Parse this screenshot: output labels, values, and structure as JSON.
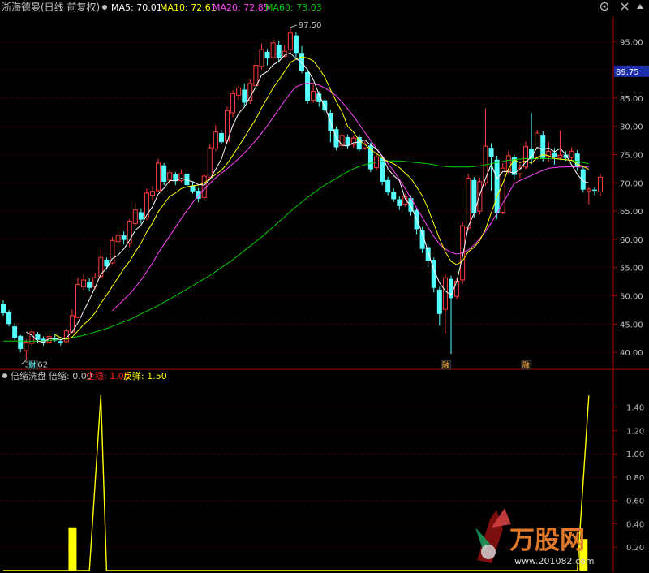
{
  "header": {
    "stock": "浙海德曼(日线 前复权)",
    "ma5": "MA5: 70.01",
    "ma10": "MA10: 72.61",
    "ma20": "MA20: 72.85",
    "ma60": "MA60: 73.03"
  },
  "indicator_header": {
    "name": "倍缩洗盘",
    "v1": "倍缩: 0.00",
    "v2": "企稳: 1.00",
    "v3": "反弹: 1.50"
  },
  "watermark": {
    "brand": "万股网",
    "url": "www.201082.com"
  },
  "colors": {
    "up": "#ff3b3b",
    "down": "#54ffff",
    "ma5": "#ffffff",
    "ma10": "#ffff00",
    "ma20": "#ff44ff",
    "ma60": "#00cc00",
    "axis": "#b00000",
    "grid": "#7a0000",
    "axis_text": "#c0c0c0",
    "bar": "#ffff00"
  },
  "chart_data": [
    {
      "type": "candlestick",
      "title": "浙海德曼(日线 前复权)",
      "y_ticks": [
        40.0,
        45.0,
        50.0,
        55.0,
        60.0,
        65.0,
        70.0,
        75.0,
        80.0,
        85.0,
        90.0,
        95.0
      ],
      "ylim": [
        37.0,
        99.5
      ],
      "y_tick_labels": [
        "40.00",
        "45.00",
        "50.00",
        "55.00",
        "60.00",
        "65.00",
        "70.00",
        "75.00",
        "80.00",
        "85.00",
        "90.00",
        "95.00"
      ],
      "current_price": "89.75",
      "current_price_value": 89.75,
      "high_label": "97.50",
      "low_label": "38.62",
      "event_markers": [
        "财",
        "融",
        "融"
      ],
      "candles": [
        [
          48.5,
          46.9,
          49.2,
          46.5
        ],
        [
          47.1,
          45.0,
          47.5,
          44.6
        ],
        [
          44.6,
          42.5,
          45.2,
          42.1
        ],
        [
          42.9,
          40.6,
          43.1,
          40.0
        ],
        [
          40.3,
          41.8,
          42.3,
          38.62
        ],
        [
          41.6,
          43.6,
          44.2,
          41.1
        ],
        [
          43.2,
          42.2,
          43.6,
          41.7
        ],
        [
          42.4,
          41.6,
          42.8,
          41.2
        ],
        [
          41.8,
          42.8,
          43.4,
          41.6
        ],
        [
          42.6,
          42.1,
          43.3,
          41.9
        ],
        [
          42.0,
          41.6,
          42.4,
          41.2
        ],
        [
          41.9,
          43.8,
          44.2,
          41.7
        ],
        [
          43.6,
          46.5,
          47.6,
          43.4
        ],
        [
          46.2,
          52.0,
          53.2,
          46.0
        ],
        [
          51.6,
          52.8,
          53.8,
          51.0
        ],
        [
          52.5,
          51.4,
          53.1,
          50.9
        ],
        [
          51.6,
          53.2,
          54.1,
          51.2
        ],
        [
          53.4,
          56.8,
          58.2,
          53.0
        ],
        [
          56.4,
          55.2,
          56.8,
          54.6
        ],
        [
          55.8,
          59.8,
          60.4,
          55.6
        ],
        [
          59.6,
          60.7,
          61.8,
          59.0
        ],
        [
          60.7,
          59.9,
          61.4,
          59.1
        ],
        [
          59.3,
          63.2,
          63.6,
          58.6
        ],
        [
          62.8,
          65.2,
          66.5,
          62.4
        ],
        [
          64.8,
          63.5,
          65.5,
          62.8
        ],
        [
          63.8,
          68.2,
          69.0,
          63.4
        ],
        [
          67.8,
          68.5,
          69.4,
          66.8
        ],
        [
          68.6,
          73.5,
          74.3,
          68.4
        ],
        [
          73.1,
          70.2,
          73.5,
          69.6
        ],
        [
          70.5,
          71.8,
          72.3,
          69.8
        ],
        [
          71.5,
          70.3,
          71.9,
          69.6
        ],
        [
          70.4,
          71.6,
          72.4,
          70.1
        ],
        [
          71.6,
          69.6,
          71.9,
          69.1
        ],
        [
          69.5,
          68.5,
          70.1,
          68.1
        ],
        [
          68.6,
          67.2,
          69.1,
          66.6
        ],
        [
          67.4,
          71.2,
          71.6,
          67.0
        ],
        [
          71.0,
          76.2,
          76.8,
          70.8
        ],
        [
          76.0,
          79.0,
          80.2,
          75.6
        ],
        [
          78.8,
          77.2,
          79.4,
          76.8
        ],
        [
          77.4,
          82.8,
          83.5,
          77.0
        ],
        [
          82.4,
          85.8,
          86.4,
          81.6
        ],
        [
          85.5,
          86.8,
          87.2,
          84.6
        ],
        [
          86.5,
          84.2,
          87.6,
          83.6
        ],
        [
          84.6,
          87.6,
          88.4,
          84.0
        ],
        [
          87.2,
          90.8,
          92.0,
          86.8
        ],
        [
          90.6,
          93.6,
          94.6,
          90.1
        ],
        [
          93.2,
          92.0,
          93.7,
          90.8
        ],
        [
          92.2,
          94.8,
          95.6,
          91.4
        ],
        [
          94.4,
          92.1,
          95.2,
          91.6
        ],
        [
          92.4,
          93.3,
          94.4,
          92.1
        ],
        [
          93.6,
          96.5,
          97.5,
          93.1
        ],
        [
          96.1,
          93.0,
          96.6,
          92.2
        ],
        [
          93.0,
          89.8,
          94.2,
          89.4
        ],
        [
          89.6,
          84.5,
          90.2,
          84.0
        ],
        [
          84.6,
          86.2,
          87.4,
          84.2
        ],
        [
          85.8,
          84.3,
          86.2,
          83.5
        ],
        [
          84.6,
          82.8,
          85.0,
          82.1
        ],
        [
          82.4,
          79.2,
          82.9,
          77.2
        ],
        [
          79.5,
          76.3,
          80.0,
          75.8
        ],
        [
          76.6,
          78.4,
          79.0,
          76.0
        ],
        [
          78.1,
          76.6,
          78.6,
          76.1
        ],
        [
          76.8,
          77.9,
          78.4,
          76.2
        ],
        [
          78.1,
          75.9,
          78.6,
          75.5
        ],
        [
          76.2,
          76.9,
          77.4,
          75.8
        ],
        [
          76.6,
          72.4,
          77.2,
          71.9
        ],
        [
          72.7,
          74.6,
          75.4,
          72.2
        ],
        [
          74.4,
          70.2,
          74.8,
          69.6
        ],
        [
          70.5,
          68.3,
          71.1,
          67.8
        ],
        [
          68.4,
          67.1,
          69.0,
          66.6
        ],
        [
          67.1,
          65.9,
          67.6,
          65.2
        ],
        [
          66.2,
          67.5,
          68.1,
          65.8
        ],
        [
          67.3,
          64.9,
          67.8,
          64.2
        ],
        [
          65.2,
          61.8,
          65.6,
          60.9
        ],
        [
          61.6,
          58.3,
          62.2,
          57.6
        ],
        [
          58.6,
          56.2,
          59.3,
          55.1
        ],
        [
          56.4,
          51.4,
          56.8,
          50.6
        ],
        [
          51.1,
          46.8,
          51.6,
          44.7
        ],
        [
          47.6,
          53.2,
          53.8,
          43.3
        ],
        [
          53.0,
          49.6,
          53.6,
          39.7
        ],
        [
          49.9,
          52.6,
          53.2,
          49.4
        ],
        [
          52.8,
          62.4,
          63.0,
          52.1
        ],
        [
          62.0,
          70.8,
          71.6,
          61.6
        ],
        [
          70.5,
          64.6,
          71.0,
          63.8
        ],
        [
          65.0,
          70.2,
          70.9,
          64.4
        ],
        [
          70.0,
          76.5,
          83.2,
          69.5
        ],
        [
          76.2,
          74.6,
          77.0,
          68.6
        ],
        [
          74.1,
          64.6,
          74.8,
          63.6
        ],
        [
          64.8,
          72.6,
          73.5,
          64.4
        ],
        [
          72.1,
          74.8,
          75.6,
          71.5
        ],
        [
          74.6,
          71.4,
          75.0,
          70.6
        ],
        [
          71.6,
          72.6,
          73.4,
          70.9
        ],
        [
          72.8,
          76.4,
          77.3,
          72.4
        ],
        [
          76.0,
          74.2,
          82.4,
          73.3
        ],
        [
          74.4,
          78.8,
          79.4,
          74.1
        ],
        [
          78.5,
          74.4,
          79.1,
          73.8
        ],
        [
          74.6,
          75.6,
          77.3,
          73.8
        ],
        [
          75.4,
          74.6,
          76.2,
          73.2
        ],
        [
          74.5,
          74.9,
          79.2,
          74.2
        ],
        [
          75.0,
          74.4,
          75.6,
          73.9
        ],
        [
          74.5,
          75.6,
          76.3,
          74.1
        ],
        [
          75.2,
          72.8,
          75.8,
          72.1
        ],
        [
          72.4,
          68.8,
          73.0,
          68.3
        ],
        [
          68.6,
          68.9,
          69.4,
          66.2
        ],
        [
          68.8,
          68.6,
          69.2,
          67.8
        ],
        [
          68.4,
          71.0,
          71.6,
          67.6
        ]
      ],
      "ma5": [
        null,
        null,
        null,
        null,
        43.6,
        43.0,
        42.0,
        41.8,
        42.4,
        42.5,
        42.2,
        42.6,
        43.6,
        45.2,
        47.3,
        49.3,
        51.5,
        53.8,
        54.9,
        56.6,
        57.2,
        58.3,
        59.8,
        61.6,
        62.5,
        64.3,
        65.8,
        68.0,
        69.1,
        70.4,
        70.4,
        70.8,
        70.5,
        70.2,
        69.7,
        69.6,
        70.6,
        72.4,
        74.2,
        77.3,
        80.2,
        82.3,
        83.4,
        85.2,
        87.0,
        89.1,
        89.7,
        90.9,
        91.5,
        92.6,
        93.0,
        92.0,
        91.3,
        90.0,
        88.3,
        85.6,
        83.5,
        80.8,
        78.0,
        76.7,
        76.5,
        77.1,
        77.2,
        77.6,
        76.7,
        76.0,
        74.7,
        72.5,
        71.3,
        70.4,
        67.2,
        65.9,
        63.6,
        61.1,
        57.8,
        54.6,
        52.3,
        50.9,
        50.1,
        52.6,
        57.0,
        62.3,
        64.6,
        67.9,
        70.8,
        73.3,
        70.7,
        72.0,
        72.0,
        71.7,
        72.4,
        73.7,
        74.6,
        76.3,
        75.9,
        76.2,
        75.5,
        76.1,
        75.0,
        73.2,
        71.5,
        70.3,
        70.0
      ],
      "ma10": [
        null,
        null,
        null,
        null,
        null,
        null,
        null,
        null,
        null,
        43.1,
        42.6,
        42.3,
        42.7,
        43.8,
        44.9,
        45.8,
        47.0,
        48.7,
        50.1,
        51.7,
        53.2,
        54.8,
        56.1,
        57.8,
        59.3,
        61.3,
        62.9,
        64.9,
        66.3,
        67.6,
        68.2,
        69.0,
        69.3,
        69.5,
        69.6,
        70.0,
        70.7,
        71.5,
        72.2,
        73.4,
        74.9,
        76.5,
        78.0,
        79.7,
        81.3,
        83.3,
        85.0,
        86.8,
        88.2,
        89.7,
        91.3,
        91.9,
        92.3,
        92.1,
        91.6,
        90.3,
        88.7,
        86.5,
        84.4,
        82.6,
        80.0,
        79.0,
        77.5,
        76.8,
        75.9,
        75.2,
        74.4,
        73.8,
        73.4,
        72.7,
        71.7,
        70.8,
        69.3,
        67.7,
        65.4,
        62.7,
        60.1,
        57.8,
        56.1,
        55.5,
        56.2,
        57.8,
        58.6,
        59.8,
        61.8,
        64.7,
        67.5,
        69.9,
        72.5,
        74.1,
        73.6,
        73.9,
        73.5,
        74.5,
        75.0,
        74.8,
        74.3,
        74.2,
        74.1,
        74.0,
        73.3,
        72.9,
        72.4
      ],
      "ma20": [
        null,
        null,
        null,
        null,
        null,
        null,
        null,
        null,
        null,
        null,
        null,
        null,
        null,
        null,
        null,
        null,
        null,
        null,
        null,
        47.4,
        48.3,
        49.3,
        50.3,
        51.5,
        52.8,
        54.3,
        55.8,
        57.6,
        59.1,
        60.6,
        62.1,
        63.7,
        65.1,
        66.5,
        67.7,
        68.9,
        69.9,
        70.9,
        71.7,
        72.5,
        73.4,
        74.3,
        75.3,
        76.4,
        77.5,
        78.8,
        80.1,
        81.6,
        83.0,
        84.5,
        85.9,
        87.0,
        87.4,
        87.7,
        87.6,
        87.3,
        86.8,
        86.2,
        85.4,
        84.3,
        83.1,
        81.8,
        80.4,
        78.9,
        77.5,
        76.1,
        74.8,
        73.4,
        72.1,
        70.6,
        69.0,
        67.3,
        65.6,
        63.9,
        62.1,
        60.5,
        59.1,
        58.3,
        57.7,
        57.4,
        57.6,
        58.1,
        59.0,
        60.1,
        61.4,
        62.9,
        64.6,
        66.4,
        68.1,
        69.9,
        70.4,
        70.9,
        71.3,
        71.8,
        72.2,
        72.6,
        72.7,
        72.8,
        72.8,
        72.9,
        72.8,
        72.8,
        72.8
      ],
      "ma60": [
        42.0,
        42.0,
        42.0,
        42.0,
        42.0,
        42.0,
        42.0,
        42.0,
        42.1,
        42.2,
        42.3,
        42.4,
        42.6,
        42.8,
        43.0,
        43.3,
        43.6,
        43.9,
        44.2,
        44.6,
        45.0,
        45.4,
        45.8,
        46.3,
        46.8,
        47.3,
        47.8,
        48.3,
        48.9,
        49.4,
        50.0,
        50.6,
        51.2,
        51.8,
        52.4,
        53.0,
        53.6,
        54.3,
        55.0,
        55.7,
        56.4,
        57.2,
        58.0,
        58.8,
        59.6,
        60.4,
        61.3,
        62.2,
        63.1,
        64.0,
        64.9,
        65.8,
        66.6,
        67.4,
        68.2,
        68.9,
        69.6,
        70.2,
        70.8,
        71.4,
        72.0,
        72.5,
        72.9,
        73.2,
        73.5,
        73.7,
        73.8,
        73.9,
        73.9,
        73.9,
        73.8,
        73.7,
        73.6,
        73.5,
        73.4,
        73.2,
        73.0,
        72.9,
        72.8,
        72.8,
        72.8,
        72.8,
        72.9,
        73.0,
        73.2,
        73.4,
        73.6,
        73.8,
        74.0,
        74.1,
        74.2,
        74.3,
        74.3,
        74.3,
        74.3,
        74.3,
        74.3,
        74.2,
        74.1,
        74.0,
        73.8,
        73.6,
        73.4
      ]
    },
    {
      "type": "bar",
      "title": "倍缩洗盘",
      "series_labels": [
        "倍缩",
        "企稳",
        "反弹"
      ],
      "y_ticks": [
        0.2,
        0.4,
        0.6,
        0.8,
        1.0,
        1.2,
        1.4
      ],
      "ylim": [
        0.0,
        1.62
      ],
      "y_tick_labels": [
        "0.20",
        "0.40",
        "0.60",
        "0.80",
        "1.00",
        "1.20",
        "1.40"
      ],
      "bars": [
        {
          "index": 12,
          "value": 0.37
        },
        {
          "index": 101,
          "value": 0.27
        }
      ],
      "line_points": [
        [
          0,
          0.0
        ],
        [
          15,
          0.0
        ],
        [
          17,
          1.5
        ],
        [
          18,
          0.0
        ],
        [
          100,
          0.0
        ],
        [
          102,
          1.5
        ]
      ]
    }
  ]
}
